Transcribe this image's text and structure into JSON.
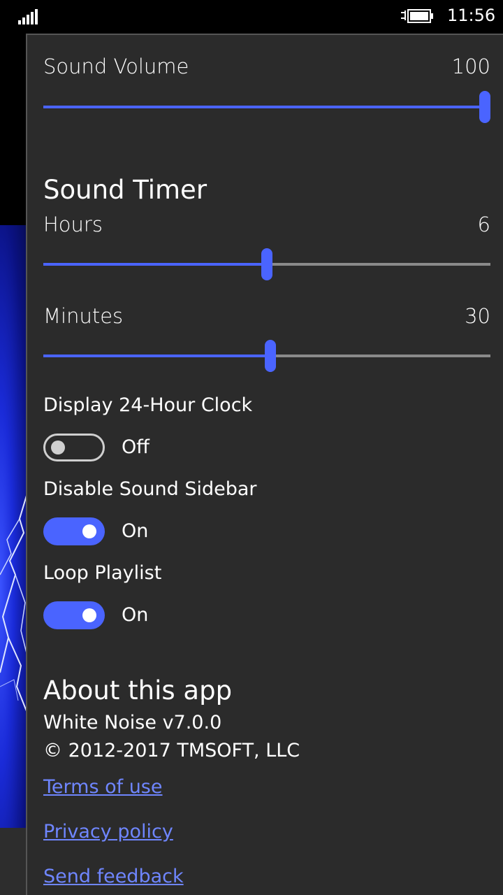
{
  "status_bar": {
    "time": "11:56"
  },
  "settings": {
    "sound_volume": {
      "label": "Sound Volume",
      "value": "100",
      "fraction": 1.0
    },
    "sound_timer": {
      "title": "Sound Timer",
      "hours": {
        "label": "Hours",
        "value": "6",
        "fraction": 0.5
      },
      "minutes": {
        "label": "Minutes",
        "value": "30",
        "fraction": 0.508
      }
    },
    "toggles": [
      {
        "label": "Display 24-Hour Clock",
        "state": "Off",
        "on": false
      },
      {
        "label": "Disable Sound Sidebar",
        "state": "On",
        "on": true
      },
      {
        "label": "Loop Playlist",
        "state": "On",
        "on": true
      }
    ]
  },
  "about": {
    "title": "About this app",
    "version": "White Noise v7.0.0",
    "copyright": "© 2012-2017 TMSOFT, LLC",
    "links": {
      "terms": "Terms of use",
      "privacy": "Privacy policy",
      "feedback": "Send feedback"
    }
  },
  "colors": {
    "accent": "#4a64ff",
    "panel_bg": "#2b2b2b",
    "link": "#6f86ff"
  },
  "icons": [
    "signal-strength-icon",
    "battery-charging-icon"
  ]
}
